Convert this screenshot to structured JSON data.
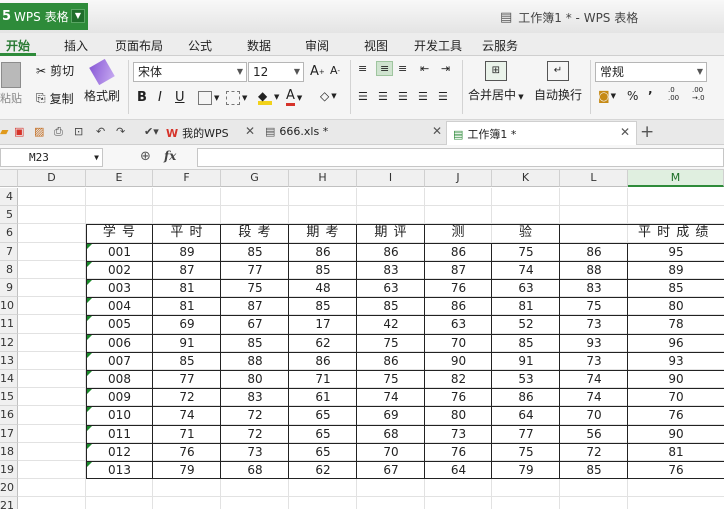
{
  "app": {
    "logo_glyph": "5",
    "name": "WPS 表格",
    "title": "工作簿1 * - WPS 表格"
  },
  "menu": [
    "开始",
    "插入",
    "页面布局",
    "公式",
    "数据",
    "审阅",
    "视图",
    "开发工具",
    "云服务"
  ],
  "ribbon": {
    "paste": "粘贴",
    "cut": "剪切",
    "copy": "复制",
    "format_painter": "格式刷",
    "font_name": "宋体",
    "font_size": "12",
    "bold": "B",
    "italic": "I",
    "underline": "U",
    "merge_center": "合并居中",
    "wrap_text": "自动换行",
    "number_format": "常规",
    "percent": "%",
    "comma": "’",
    "inc_decimal": ".0 .00",
    "dec_decimal": ".00 →.0"
  },
  "doc_tabs": [
    {
      "label": "我的WPS"
    },
    {
      "label": "666.xls *"
    },
    {
      "label": "工作簿1 *",
      "active": true
    }
  ],
  "formula_bar": {
    "name_box": "M23",
    "fx": "fx",
    "content": ""
  },
  "columns": [
    "D",
    "E",
    "F",
    "G",
    "H",
    "I",
    "J",
    "K",
    "L",
    "M"
  ],
  "selected_column": "M",
  "rows": [
    "4",
    "5",
    "6",
    "7",
    "8",
    "9",
    "10",
    "11",
    "12",
    "13",
    "14",
    "15",
    "16",
    "17",
    "18",
    "19",
    "20",
    "21"
  ],
  "table_headers": [
    "学 号",
    "平 时",
    "段 考",
    "期 考",
    "期 评",
    "测",
    "验",
    "平 时 成 绩"
  ],
  "table_rows": [
    [
      "001",
      "89",
      "85",
      "86",
      "86",
      "86",
      "75",
      "86",
      "95"
    ],
    [
      "002",
      "87",
      "77",
      "85",
      "83",
      "87",
      "74",
      "88",
      "89"
    ],
    [
      "003",
      "81",
      "75",
      "48",
      "63",
      "76",
      "63",
      "83",
      "85"
    ],
    [
      "004",
      "81",
      "87",
      "85",
      "85",
      "86",
      "81",
      "75",
      "80"
    ],
    [
      "005",
      "69",
      "67",
      "17",
      "42",
      "63",
      "52",
      "73",
      "78"
    ],
    [
      "006",
      "91",
      "85",
      "62",
      "75",
      "70",
      "85",
      "93",
      "96"
    ],
    [
      "007",
      "85",
      "88",
      "86",
      "86",
      "90",
      "91",
      "73",
      "93"
    ],
    [
      "008",
      "77",
      "80",
      "71",
      "75",
      "82",
      "53",
      "74",
      "90"
    ],
    [
      "009",
      "72",
      "83",
      "61",
      "74",
      "76",
      "86",
      "74",
      "70"
    ],
    [
      "010",
      "74",
      "72",
      "65",
      "69",
      "80",
      "64",
      "70",
      "76"
    ],
    [
      "011",
      "71",
      "72",
      "65",
      "68",
      "73",
      "77",
      "56",
      "90"
    ],
    [
      "012",
      "76",
      "73",
      "65",
      "70",
      "76",
      "75",
      "72",
      "81"
    ],
    [
      "013",
      "79",
      "68",
      "62",
      "67",
      "64",
      "79",
      "85",
      "76"
    ]
  ],
  "colors": {
    "accent": "#2e8b3a",
    "wps_red": "#d6332a"
  }
}
